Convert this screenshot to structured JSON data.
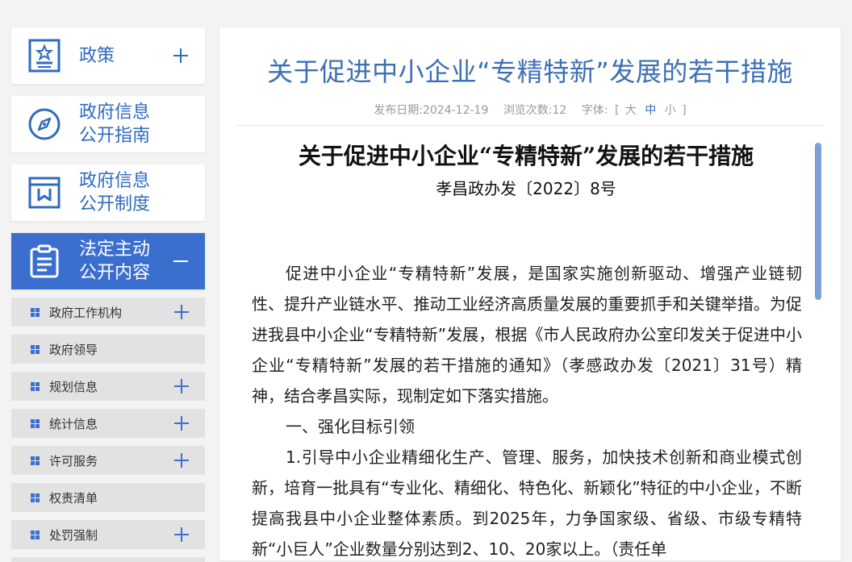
{
  "sidebar": {
    "cards": [
      {
        "label": "政策",
        "icon": "policy-doc-star-icon",
        "toggle": "+"
      },
      {
        "label": "政府信息\n公开指南",
        "icon": "compass-icon",
        "toggle": ""
      },
      {
        "label": "政府信息\n公开制度",
        "icon": "archive-box-icon",
        "toggle": ""
      },
      {
        "label": "法定主动\n公开内容",
        "icon": "clipboard-icon",
        "toggle": "−"
      }
    ],
    "subitems": [
      {
        "label": "政府工作机构",
        "expandable": true
      },
      {
        "label": "政府领导",
        "expandable": false
      },
      {
        "label": "规划信息",
        "expandable": true
      },
      {
        "label": "统计信息",
        "expandable": true
      },
      {
        "label": "许可服务",
        "expandable": true
      },
      {
        "label": "权责清单",
        "expandable": false
      },
      {
        "label": "处罚强制",
        "expandable": true
      }
    ],
    "active_color": "#3b6fcf",
    "accent_color": "#2f6bbf"
  },
  "article": {
    "title": "关于促进中小企业“专精特新”发展的若干措施",
    "publish_date": "发布日期:2024-12-19",
    "views": "浏览次数:12",
    "font_size_label": "字体:",
    "font_open": "[",
    "font_large": "大",
    "font_medium": "中",
    "font_small": "小",
    "font_close": "]",
    "doc_title": "关于促进中小企业“专精特新”发展的若干措施",
    "doc_number": "孝昌政办发〔2022〕8号",
    "paragraphs": [
      "促进中小企业“专精特新”发展，是国家实施创新驱动、增强产业链韧性、提升产业链水平、推动工业经济高质量发展的重要抓手和关键举措。为促进我县中小企业“专精特新”发展，根据《市人民政府办公室印发关于促进中小企业“专精特新”发展的若干措施的通知》（孝感政办发〔2021〕31号）精神，结合孝昌实际，现制定如下落实措施。",
      "一、强化目标引领",
      "1.引导中小企业精细化生产、管理、服务，加快技术创新和商业模式创新，培育一批具有“专业化、精细化、特色化、新颖化”特征的中小企业，不断提高我县中小企业整体素质。到2025年，力争国家级、省级、市级专精特新“小巨人”企业数量分别达到2、10、20家以上。（责任单"
    ]
  }
}
